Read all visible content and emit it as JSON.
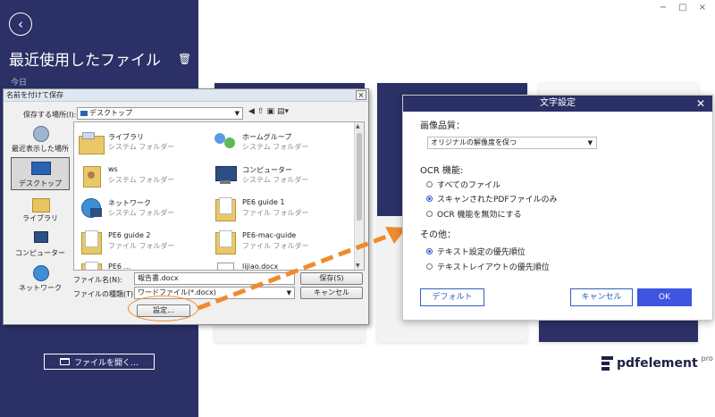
{
  "app": {
    "window_controls": [
      "−",
      "□",
      "×"
    ],
    "brand": {
      "name": "pdfelement",
      "tier": "pro"
    }
  },
  "sidebar": {
    "back_symbol": "‹",
    "title": "最近使用したファイル",
    "trash_symbol": "🗑",
    "today_label": "今日",
    "open_file_label": "ファイルを開く…"
  },
  "save_dialog": {
    "title": "名前を付けて保存",
    "close_symbol": "×",
    "location_label": "保存する場所(I):",
    "location_value": "デスクトップ",
    "tool_icons": [
      "◀",
      "⇧",
      "▣",
      "▤▾"
    ],
    "places": [
      {
        "label": "最近表示した場所",
        "icon": "recent-icon"
      },
      {
        "label": "デスクトップ",
        "icon": "desktop-icon",
        "selected": true
      },
      {
        "label": "ライブラリ",
        "icon": "library-icon"
      },
      {
        "label": "コンピューター",
        "icon": "computer-icon"
      },
      {
        "label": "ネットワーク",
        "icon": "network-icon"
      }
    ],
    "files": [
      {
        "name": "ライブラリ",
        "type": "システム フォルダー",
        "icon": "library-folder-icon"
      },
      {
        "name": "ホームグループ",
        "type": "システム フォルダー",
        "icon": "homegroup-icon"
      },
      {
        "name": "ws",
        "type": "システム フォルダー",
        "icon": "user-folder-icon"
      },
      {
        "name": "コンピューター",
        "type": "システム フォルダー",
        "icon": "computer-icon"
      },
      {
        "name": "ネットワーク",
        "type": "システム フォルダー",
        "icon": "network-icon"
      },
      {
        "name": "PE6 guide 1",
        "type": "ファイル フォルダー",
        "icon": "folder-icon"
      },
      {
        "name": "PE6 guide 2",
        "type": "ファイル フォルダー",
        "icon": "folder-icon"
      },
      {
        "name": "PE6-mac-guide",
        "type": "ファイル フォルダー",
        "icon": "folder-icon"
      },
      {
        "name": "PE6 ...",
        "type": "",
        "icon": "folder-icon"
      },
      {
        "name": "lijiao.docx",
        "type": "",
        "icon": "word-doc-icon"
      }
    ],
    "filename_label": "ファイル名(N):",
    "filename_value": "報告書.docx",
    "filetype_label": "ファイルの種類(T):",
    "filetype_value": "ワードファイル(*.docx)",
    "save_button": "保存(S)",
    "cancel_button": "キャンセル",
    "settings_button": "設定..."
  },
  "text_settings": {
    "title": "文字設定",
    "close_symbol": "✕",
    "image_quality_label": "画像品質：",
    "image_quality_value": "オリジナルの解像度を保つ",
    "ocr_label": "OCR 機能:",
    "ocr_options": [
      {
        "label": "すべてのファイル",
        "selected": false
      },
      {
        "label": "スキャンされたPDFファイルのみ",
        "selected": true
      },
      {
        "label": "OCR 機能を無効にする",
        "selected": false
      }
    ],
    "other_label": "その他：",
    "other_options": [
      {
        "label": "テキスト設定の優先順位",
        "selected": true
      },
      {
        "label": "テキストレイアウトの優先順位",
        "selected": false
      }
    ],
    "default_button": "デフォルト",
    "cancel_button": "キャンセル",
    "ok_button": "OK"
  },
  "colors": {
    "sidebar": "#2b3166",
    "accent_orange": "#f08a2e",
    "ok_button": "#3d55e0"
  }
}
